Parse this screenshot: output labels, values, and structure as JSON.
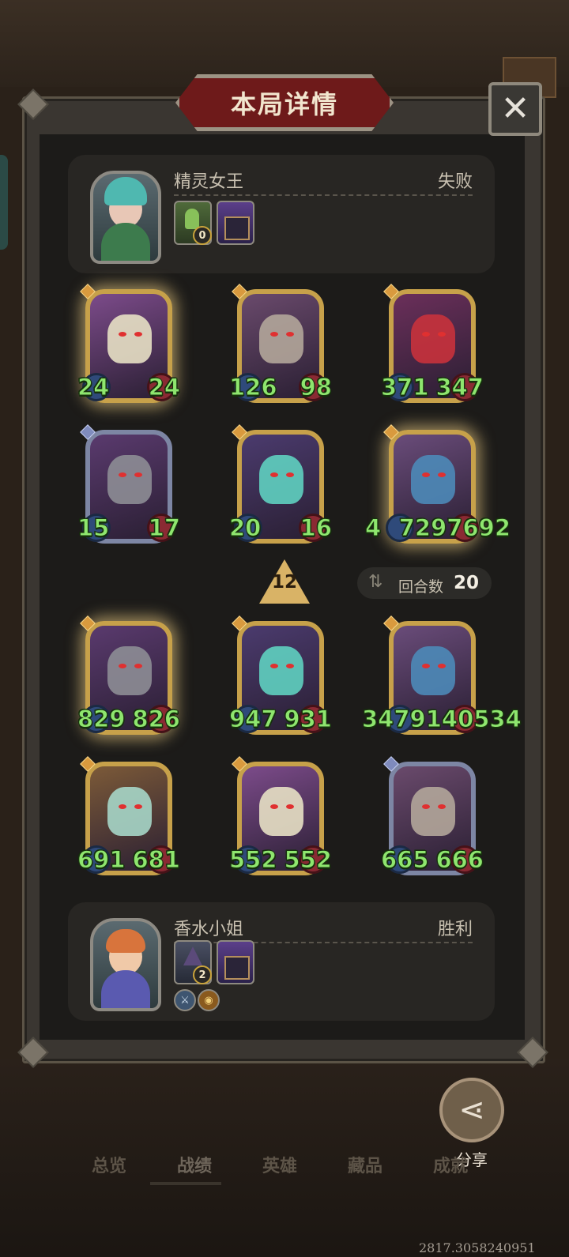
{
  "header": {
    "title": "本局详情",
    "close_icon": "close-icon"
  },
  "opponent": {
    "name": "精灵女王",
    "result": "失败",
    "portrait": "elf-queen-portrait",
    "badges": [
      {
        "icon": "green-hand-icon",
        "count": "0"
      },
      {
        "icon": "tavern-icon"
      }
    ]
  },
  "opponent_board": [
    {
      "atk": "24",
      "hp": "24",
      "art": "white-dragon",
      "style": "gold-glow"
    },
    {
      "atk": "126",
      "hp": "98",
      "art": "horned-beast",
      "style": "gold"
    },
    {
      "atk": "371",
      "hp": "347",
      "art": "red-dragon",
      "style": "gold"
    },
    {
      "atk": "15",
      "hp": "17",
      "art": "gray-dragon",
      "style": "silver"
    },
    {
      "atk": "20",
      "hp": "16",
      "art": "shadow-dragon",
      "style": "gold"
    },
    {
      "atk": "47297",
      "atk_display": "4",
      "hp": "7297692",
      "art": "blue-dragon",
      "style": "gold-glow"
    }
  ],
  "turn_marker": {
    "value": "12"
  },
  "rounds": {
    "label": "回合数",
    "value": "20",
    "icon": "swap-icon"
  },
  "player_board": [
    {
      "atk": "829",
      "hp": "826",
      "art": "gray-dragon",
      "style": "gold-glow"
    },
    {
      "atk": "947",
      "hp": "931",
      "art": "shadow-dragon",
      "style": "gold"
    },
    {
      "atk": "3479140534",
      "art": "blue-dragon",
      "style": "gold"
    },
    {
      "atk": "691",
      "hp": "681",
      "art": "officer",
      "style": "gold"
    },
    {
      "atk": "552",
      "hp": "552",
      "art": "white-dragon",
      "style": "gold"
    },
    {
      "atk": "665",
      "hp": "666",
      "art": "horned-beast",
      "style": "silver"
    }
  ],
  "player": {
    "name": "香水小姐",
    "result": "胜利",
    "portrait": "perfume-lady-portrait",
    "badges": [
      {
        "icon": "wizard-icon",
        "count": "2"
      },
      {
        "icon": "tavern-icon"
      }
    ],
    "perks": [
      "sword-perk-icon",
      "gold-perk-icon"
    ]
  },
  "share": {
    "label": "分享",
    "icon": "share-icon"
  },
  "tabs": [
    "总览",
    "战绩",
    "英雄",
    "藏品",
    "成就"
  ],
  "active_tab": "战绩",
  "debug_coords": "2817.3058240951"
}
